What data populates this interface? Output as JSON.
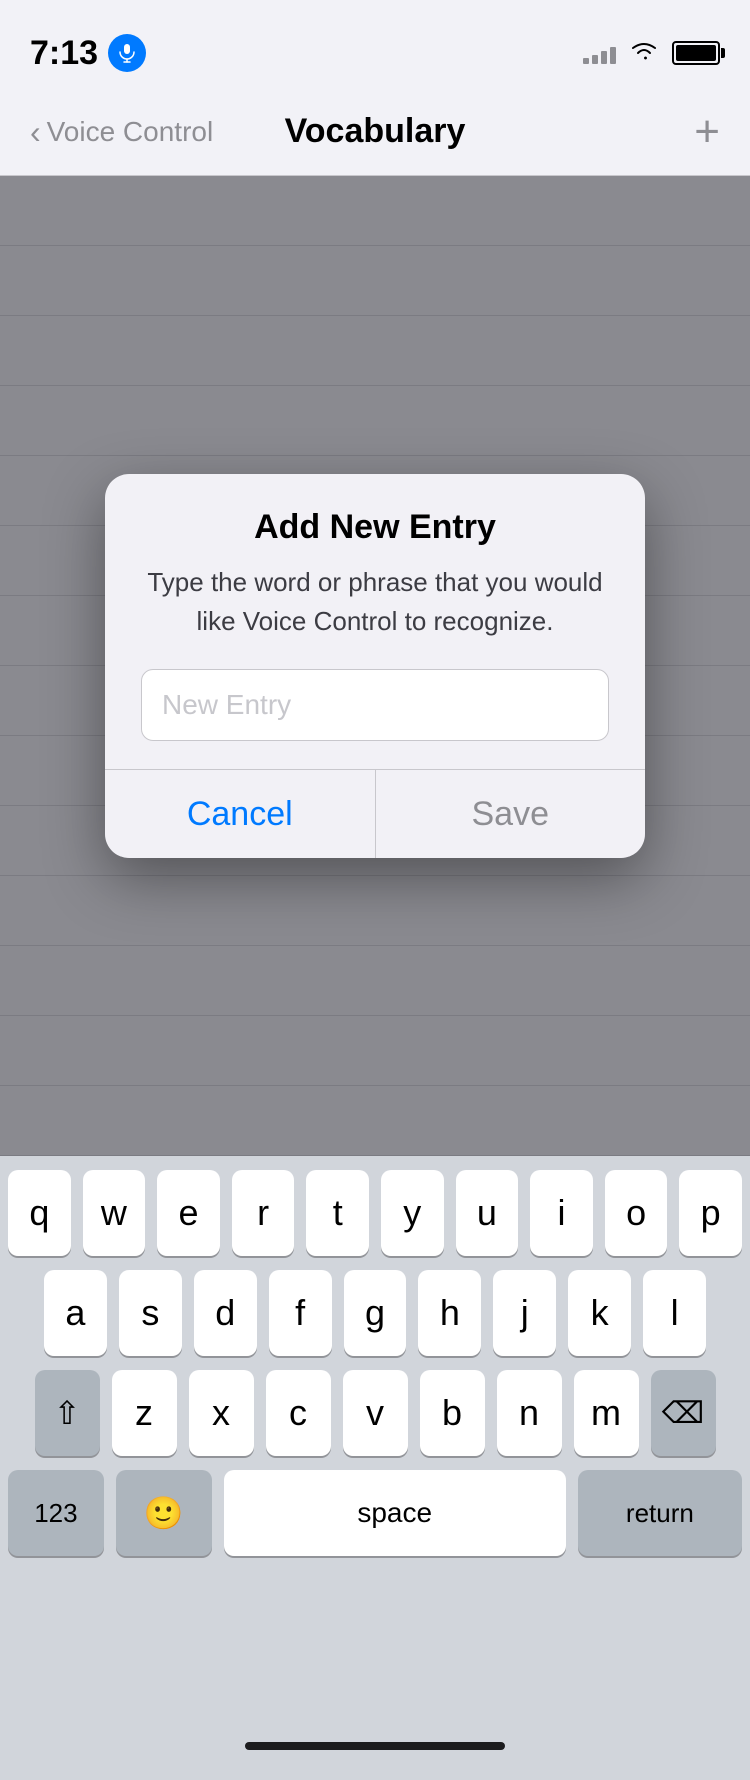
{
  "statusBar": {
    "time": "7:13",
    "micActive": true
  },
  "navBar": {
    "backLabel": "Voice Control",
    "title": "Vocabulary",
    "addLabel": "+"
  },
  "dialog": {
    "title": "Add New Entry",
    "message": "Type the word or phrase that you would like Voice Control to recognize.",
    "inputPlaceholder": "New Entry",
    "cancelLabel": "Cancel",
    "saveLabel": "Save"
  },
  "keyboard": {
    "rows": [
      [
        "q",
        "w",
        "e",
        "r",
        "t",
        "y",
        "u",
        "i",
        "o",
        "p"
      ],
      [
        "a",
        "s",
        "d",
        "f",
        "g",
        "h",
        "j",
        "k",
        "l"
      ],
      [
        "z",
        "x",
        "c",
        "v",
        "b",
        "n",
        "m"
      ]
    ],
    "numericLabel": "123",
    "spaceLabel": "space",
    "returnLabel": "return"
  }
}
